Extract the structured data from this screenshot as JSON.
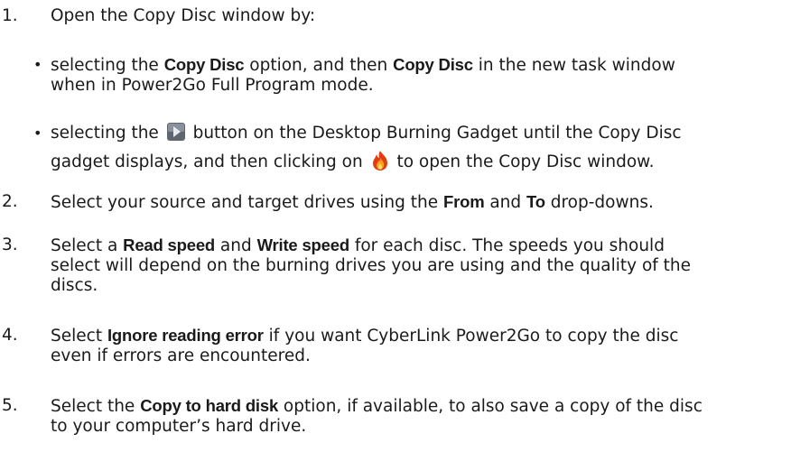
{
  "steps": [
    {
      "number": "1.",
      "text": "Open the Copy Disc window by:"
    },
    {
      "number": "2.",
      "pre": "Select your source and target drives using the ",
      "bold1": "From",
      "mid": " and ",
      "bold2": "To",
      "post": " drop-downs."
    },
    {
      "number": "3.",
      "pre": "Select a ",
      "bold1": "Read speed",
      "mid": " and ",
      "bold2": "Write speed",
      "post_line1": " for each disc. The speeds you should",
      "line2": "select will depend on the burning drives you are using and the quality of the",
      "line3": "discs."
    },
    {
      "number": "4.",
      "pre": "Select ",
      "bold1": "Ignore reading error",
      "post_line1": " if you want CyberLink Power2Go to copy the disc",
      "line2": "even if errors are encountered."
    },
    {
      "number": "5.",
      "pre": "Select the ",
      "bold1": "Copy to hard disk",
      "post_line1": " option, if available, to also save a copy of the disc",
      "line2": "to your computer’s hard drive."
    }
  ],
  "sub_bullets": [
    {
      "marker": "•",
      "pre": "selecting the ",
      "bold1": "Copy Disc",
      "mid": " option, and then ",
      "bold2": "Copy Disc",
      "post_line1": " in the new task window",
      "line2": "when in Power2Go Full Program mode."
    },
    {
      "marker": "•",
      "pre": "selecting the ",
      "icon1": "play-button-icon",
      "mid": " button on the Desktop Burning Gadget until the Copy Disc",
      "line2_pre": "gadget displays, and then clicking on ",
      "icon2": "burn-flame-icon",
      "line2_post": " to open the Copy Disc window."
    }
  ],
  "colors": {
    "text": "#1a1a1a",
    "play_icon": "#6b7280",
    "flame": "#e23b12"
  }
}
